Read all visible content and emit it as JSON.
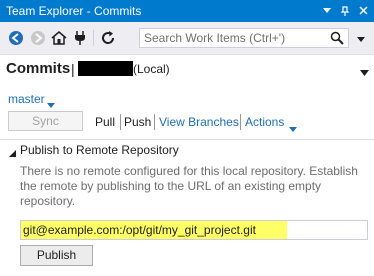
{
  "window": {
    "title": "Team Explorer - Commits",
    "dropdown_icon": "dropdown-arrow-icon",
    "pin_icon": "pin-icon",
    "close_icon": "close-icon",
    "accent_color": "#007acc"
  },
  "toolbar": {
    "search_placeholder": "Search Work Items (Ctrl+')",
    "icons": [
      "back-icon",
      "forward-icon",
      "home-icon",
      "plug-icon",
      "refresh-icon",
      "search-icon"
    ]
  },
  "header": {
    "title": "Commits",
    "separator": "|",
    "repo_suffix": "(Local)"
  },
  "branch": {
    "name": "master"
  },
  "actions": {
    "sync_label": "Sync",
    "pull_label": "Pull",
    "push_label": "Push",
    "view_branches_label": "View Branches",
    "actions_label": "Actions",
    "link_color": "#1e6fb8"
  },
  "publish_section": {
    "title": "Publish to Remote Repository",
    "description": "There is no remote configured for this local repository. Establish the remote by publishing to the URL of an existing empty repository.",
    "url_value": "git@example.com:/opt/git/my_git_project.git",
    "highlight_color": "#ffff66",
    "publish_label": "Publish"
  }
}
